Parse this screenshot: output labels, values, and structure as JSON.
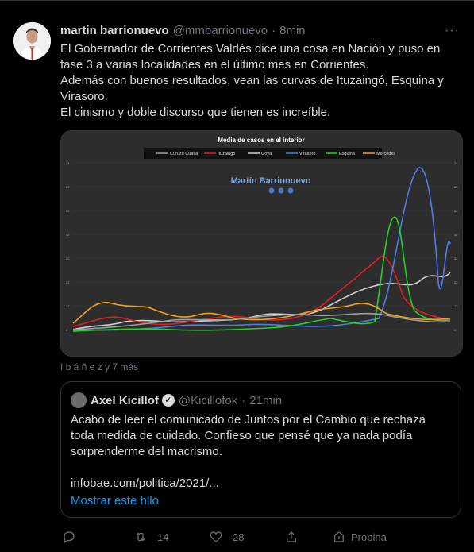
{
  "tweet": {
    "author_name": "martin barrionuevo",
    "author_handle": "@mmbarrionuevo",
    "separator": "·",
    "time": "8min",
    "more_label": "···",
    "text_lines": [
      "El Gobernador de Corrientes Valdés dice una cosa en Nación y puso en fase 3 a varias localidades en el último mes en Corrientes.",
      "Además con buenos resultados, vean las curvas de Ituzaingó, Esquina y Virasoro.",
      "El cinismo y doble discurso que tienen es increíble."
    ],
    "tagged": "I b á ñ e z y 7 más"
  },
  "chart": {
    "title": "Media de casos en el interior",
    "watermark": "Martín Barrionuevo",
    "legend": [
      {
        "name": "Curuzú Cuatiá",
        "color": "#9aa0a6"
      },
      {
        "name": "Ituzaingó",
        "color": "#e02020"
      },
      {
        "name": "Goya",
        "color": "#cfcfcf"
      },
      {
        "name": "Virasoro",
        "color": "#4f7ce6"
      },
      {
        "name": "Esquina",
        "color": "#22d12a"
      },
      {
        "name": "Mercedes",
        "color": "#f0a01a"
      }
    ]
  },
  "quote": {
    "author_name": "Axel Kicillof",
    "author_handle": "@Kicillofok",
    "separator": "·",
    "time": "21min",
    "text": "Acabo de leer el comunicado de Juntos por el Cambio que rechaza toda medida de cuidado. Confieso que pensé que ya nada podía sorprenderme del macrismo.",
    "link": "infobae.com/politica/2021/...",
    "show_thread": "Mostrar este hilo"
  },
  "actions": {
    "reply_count": "",
    "retweet_count": "14",
    "like_count": "28",
    "tip_label": "Propina"
  },
  "colors": {
    "background": "#000000",
    "text": "#d9d9d9",
    "muted": "#6e767d",
    "link": "#1d9bf0"
  }
}
